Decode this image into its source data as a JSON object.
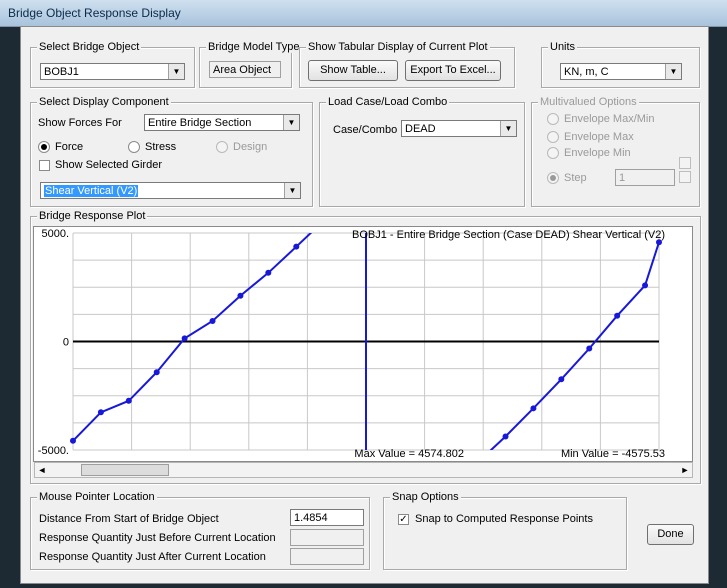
{
  "window": {
    "title": "Bridge Object Response Display"
  },
  "select_bridge_object": {
    "legend": "Select Bridge Object",
    "value": "BOBJ1"
  },
  "bridge_model_type": {
    "legend": "Bridge Model Type",
    "value": "Area Object"
  },
  "tabular": {
    "legend": "Show Tabular Display of Current Plot",
    "show_table": "Show Table...",
    "export_excel": "Export To Excel..."
  },
  "units": {
    "legend": "Units",
    "value": "KN, m, C"
  },
  "display_component": {
    "legend": "Select Display Component",
    "show_forces_label": "Show Forces For",
    "show_forces_value": "Entire Bridge Section",
    "force_label": "Force",
    "stress_label": "Stress",
    "design_label": "Design",
    "show_selected_girder": "Show Selected Girder",
    "component_value": "Shear Vertical  (V2)"
  },
  "load_case": {
    "legend": "Load Case/Load Combo",
    "label": "Case/Combo",
    "value": "DEAD"
  },
  "multivalued": {
    "legend": "Multivalued Options",
    "env_maxmin": "Envelope Max/Min",
    "env_max": "Envelope Max",
    "env_min": "Envelope Min",
    "step": "Step",
    "step_value": "1"
  },
  "plot": {
    "legend": "Bridge Response Plot"
  },
  "chart_data": {
    "type": "line",
    "title": "BOBJ1 - Entire Bridge Section   (Case DEAD)   Shear Vertical  (V2)",
    "ylim": [
      -5000,
      5000
    ],
    "yticks": [
      "5000.",
      "0",
      "-5000."
    ],
    "xlim": [
      0,
      1
    ],
    "grid": true,
    "max_label": "Max Value = 4574.802",
    "min_label": "Min Value = -4575.53",
    "series": [
      {
        "x": [
          0,
          0.0476,
          0.0952,
          0.1429,
          0.1905,
          0.2381,
          0.2857,
          0.3333,
          0.381,
          0.4286,
          0.4762,
          0.5
        ],
        "values": [
          -4575,
          -3262,
          -2733,
          -1417,
          143,
          944,
          2109,
          3167,
          4370,
          5592,
          7004,
          9036
        ]
      },
      {
        "x": [
          0.5,
          0.5,
          0.5476,
          0.5952,
          0.6429,
          0.6905,
          0.7381,
          0.7857,
          0.8333,
          0.881,
          0.9286,
          0.9762,
          1.0
        ],
        "values": [
          9036,
          -11164,
          -9800,
          -8278,
          -6990,
          -5578,
          -4376,
          -3079,
          -1742,
          -323,
          1189,
          2589,
          4575
        ]
      }
    ]
  },
  "mouse": {
    "legend": "Mouse Pointer Location",
    "distance_label": "Distance From Start of Bridge Object",
    "distance_value": "1.4854",
    "before_label": "Response Quantity Just Before Current Location",
    "after_label": "Response Quantity Just After Current Location"
  },
  "snap": {
    "legend": "Snap Options",
    "label": "Snap to Computed Response Points"
  },
  "done": "Done"
}
